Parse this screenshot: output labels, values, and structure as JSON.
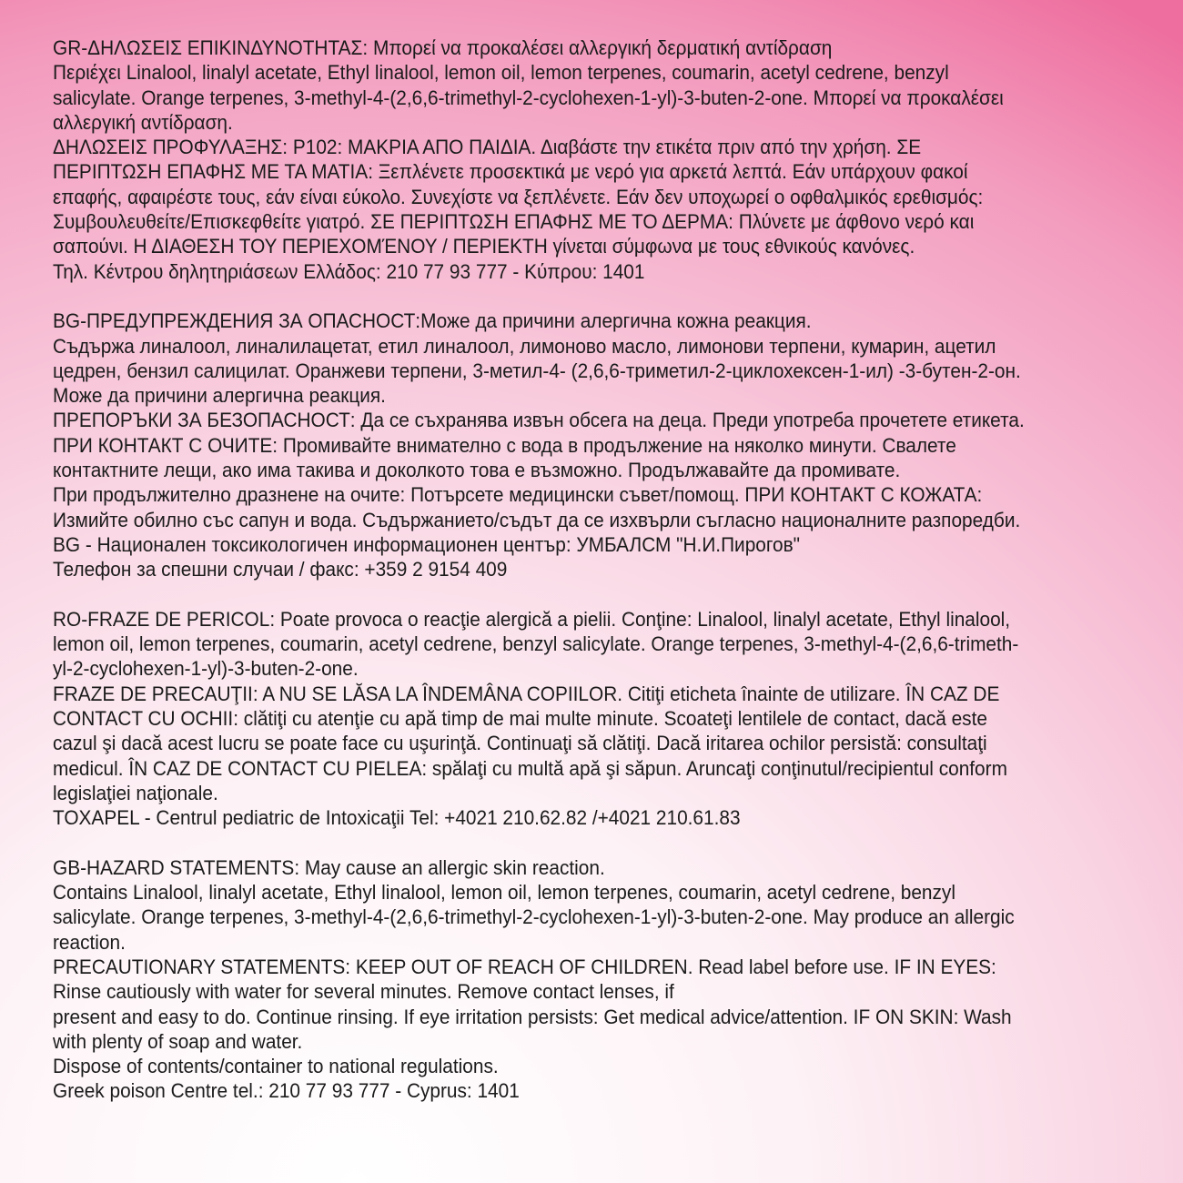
{
  "sections": [
    {
      "lang": "GR",
      "lines": [
        "GR-ΔΗΛΩΣΕΙΣ ΕΠΙΚΙΝΔΥΝΟΤΗΤΑΣ:  Μπορεί να προκαλέσει αλλεργική δερματική αντίδραση",
        "Περιέχει Linalool, linalyl acetate, Ethyl linalool, lemon oil, lemon terpenes, coumarin, acetyl cedrene, benzyl",
        "salicylate. Orange terpenes, 3-methyl-4-(2,6,6-trimethyl-2-cyclohexen-1-yl)-3-buten-2-one. Μπορεί να προκαλέσει",
        "αλλεργική αντίδραση.",
        "ΔΗΛΩΣΕΙΣ ΠΡΟΦΥΛΑΞΗΣ: P102: ΜΑΚΡΙΑ ΑΠΟ ΠΑΙΔΙΑ. Διαβάστε την ετικέτα πριν από την χρήση. ΣΕ",
        "ΠΕΡΙΠΤΩΣΗ ΕΠΑΦΗΣ ΜΕ ΤΑ ΜΑΤΙΑ: Ξεπλένετε προσεκτικά με νερό για αρκετά λεπτά. Εάν υπάρχουν φακοί",
        "επαφής, αφαιρέστε τους, εάν είναι εύκολο. Συνεχίστε να ξεπλένετε.  Εάν δεν υποχωρεί ο οφθαλμικός ερεθισμός:",
        "Συμβουλευθείτε/Επισκεφθείτε γιατρό. ΣΕ ΠΕΡΙΠΤΩΣΗ ΕΠΑΦΗΣ ΜΕ ΤΟ ΔΕΡΜΑ: Πλύνετε με άφθονο νερό και",
        "σαπούνι. Η ΔΙΑΘΕΣΗ ΤΟΥ ΠΕΡΙΕΧΟΜΈΝΟΥ / ΠΕΡΙΕΚΤΗ γίνεται σύμφωνα με τους εθνικούς κανόνες.",
        "Τηλ. Κέντρου δηλητηριάσεων Ελλάδος: 210 77 93 777 - Κύπρου: 1401"
      ]
    },
    {
      "lang": "BG",
      "lines": [
        "BG-ПРЕДУПРЕЖДЕНИЯ ЗА ОПАСНОСТ:Може да причини алергична кожна реакция.",
        "Съдържа линалоол, линалилацетат, етил линалоол, лимоново масло, лимонови терпени, кумарин, ацетил",
        "цедрен, бензил салицилат. Оранжеви терпени, 3-метил-4- (2,6,6-триметил-2-циклохексен-1-ил) -3-бутен-2-он.",
        " Може да причини алергична реакция.",
        "ПРЕПОРЪКИ ЗА БЕЗОПАСНОСТ: Да се съхранява извън обсега на деца. Преди употреба прочетете етикета.",
        "ПРИ КОНТАКТ С ОЧИТЕ: Промивайте внимателно с вода в продължение на няколко минути. Свалете",
        "контактните лещи, ако има такива и доколкото това е възможно. Продължавайте да промивате.",
        "При продължително дразнене на очите: Потърсете медицински съвет/помощ. ПРИ КОНТАКТ С КОЖАТА:",
        "Измийте обилно със сапун и вода. Съдържанието/съдът да се изхвърли съгласно националните разпоредби.",
        "BG - Национален токсикологичен информационен център: УМБАЛСМ \"Н.И.Пирогов\"",
        "Телефон за спешни случаи / факс: +359 2 9154 409"
      ]
    },
    {
      "lang": "RO",
      "lines": [
        "RO-FRAZE DE PERICOL: Poate provoca o reacţie alergică a pielii. Conţine: Linalool, linalyl acetate, Ethyl linalool,",
        "lemon oil, lemon terpenes, coumarin, acetyl cedrene, benzyl salicylate. Orange terpenes, 3-methyl-4-(2,6,6-trimeth-",
        "yl-2-cyclohexen-1-yl)-3-buten-2-one.",
        "FRAZE DE  PRECAUŢII: A NU SE LĂSA LA ÎNDEMÂNA COPIILOR. Citiţi eticheta înainte de utilizare. ÎN CAZ DE",
        "CONTACT CU OCHII: clătiţi cu atenţie cu apă timp de mai multe minute. Scoateţi lentilele de contact, dacă este",
        "cazul şi dacă acest lucru se poate face cu uşurinţă. Continuaţi să clătiţi. Dacă iritarea ochilor persistă: consultaţi",
        "medicul. ÎN CAZ DE CONTACT CU PIELEA: spălaţi cu multă apă şi săpun. Aruncaţi conţinutul/recipientul conform",
        "legislaţiei naţionale.",
        "TOXAPEL - Centrul pediatric de Intoxicaţii Tel: +4021 210.62.82  /+4021 210.61.83"
      ]
    },
    {
      "lang": "GB",
      "lines": [
        "GB-HAZARD STATEMENTS: May cause an allergic skin reaction.",
        "Contains Linalool, linalyl acetate, Ethyl linalool, lemon oil, lemon terpenes, coumarin, acetyl cedrene, benzyl",
        "salicylate. Orange terpenes, 3-methyl-4-(2,6,6-trimethyl-2-cyclohexen-1-yl)-3-buten-2-one. May produce an allergic",
        "reaction.",
        "PRECAUTIONARY STATEMENTS: KEEP OUT OF REACH OF CHILDREN. Read label before use. IF IN EYES:",
        "Rinse cautiously with water for several minutes. Remove contact lenses, if",
        "present and easy to do. Continue rinsing. If eye irritation persists: Get medical advice/attention. IF ON SKIN: Wash",
        "with plenty of soap and water.",
        "Dispose of contents/container to national regulations.",
        "Greek poison Centre tel.: 210 77 93 777 - Cyprus: 1401"
      ]
    }
  ]
}
